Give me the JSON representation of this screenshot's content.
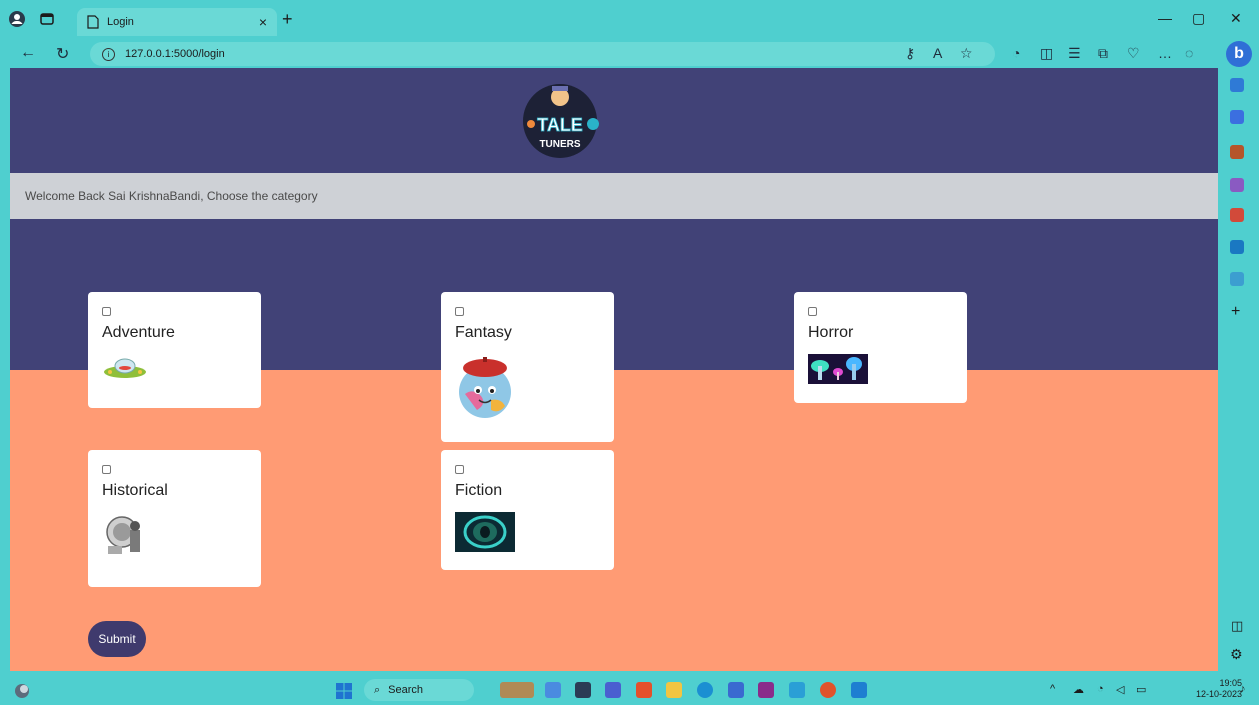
{
  "browser": {
    "tab_title": "Login",
    "tab_close": "×",
    "new_tab": "+",
    "url": "127.0.0.1:5000/login",
    "window_controls": {
      "minimize": "—",
      "restore": "▢",
      "close": "✕"
    },
    "nav_icons": [
      "back-arrow-icon",
      "refresh-icon",
      "info-icon"
    ],
    "toolbar_icons": [
      "key-icon",
      "read-aloud-icon",
      "favorite-star-icon",
      "extensions-icon",
      "split-screen-icon",
      "favorites-icon",
      "collections-icon",
      "heart-icon",
      "more-icon"
    ],
    "sidebar_icons": [
      "search-icon",
      "tag-icon",
      "briefcase-icon",
      "chess-icon",
      "office-icon",
      "outlook-icon",
      "send-icon",
      "add-icon",
      "layout-icon",
      "settings-icon"
    ]
  },
  "page": {
    "logo_text_top": "TALE",
    "logo_text_bottom": "TUNERS",
    "welcome": "Welcome Back Sai KrishnaBandi, Choose the category",
    "categories": [
      {
        "label": "Adventure",
        "image": "ufo-image"
      },
      {
        "label": "Fantasy",
        "image": "beret-globe-image"
      },
      {
        "label": "Horror",
        "image": "mushroom-forest-image"
      },
      {
        "label": "Historical",
        "image": "knight-armor-image"
      },
      {
        "label": "Fiction",
        "image": "portal-image"
      }
    ],
    "submit_label": "Submit"
  },
  "taskbar": {
    "search_label": "Search",
    "time": "19:05",
    "date": "12-10-2023"
  },
  "colors": {
    "hero": "#414277",
    "body": "#ff9b74",
    "chrome": "#4fcfcf",
    "button": "#3f3a6d"
  }
}
